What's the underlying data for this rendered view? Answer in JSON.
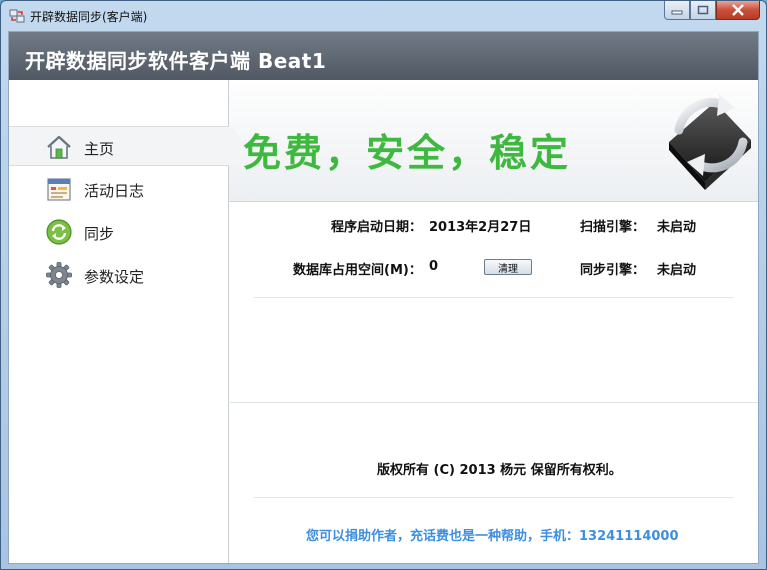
{
  "window": {
    "title": "开辟数据同步(客户端)",
    "header_title": "开辟数据同步软件客户端 Beat1"
  },
  "sidebar": {
    "items": [
      {
        "label": "主页",
        "icon": "home-icon",
        "active": true
      },
      {
        "label": "活动日志",
        "icon": "log-icon",
        "active": false
      },
      {
        "label": "同步",
        "icon": "sync-icon",
        "active": false
      },
      {
        "label": "参数设定",
        "icon": "gear-icon",
        "active": false
      }
    ]
  },
  "banner": {
    "slogan": "免费，安全，稳定",
    "slogan_color": "#3fb83f"
  },
  "info": {
    "start_date_label": "程序启动日期：",
    "start_date_value": "2013年2月27日",
    "db_space_label": "数据库占用空间(M)：",
    "db_space_value": "0",
    "clear_button": "清理",
    "scan_engine_label": "扫描引擎：",
    "scan_engine_value": "未启动",
    "sync_engine_label": "同步引擎：",
    "sync_engine_value": "未启动"
  },
  "footer": {
    "copyright": "版权所有 (C) 2013 杨元 保留所有权利。",
    "donate": "您可以捐助作者，充话费也是一种帮助，手机：13241114000",
    "donate_color": "#3d8fe0"
  }
}
